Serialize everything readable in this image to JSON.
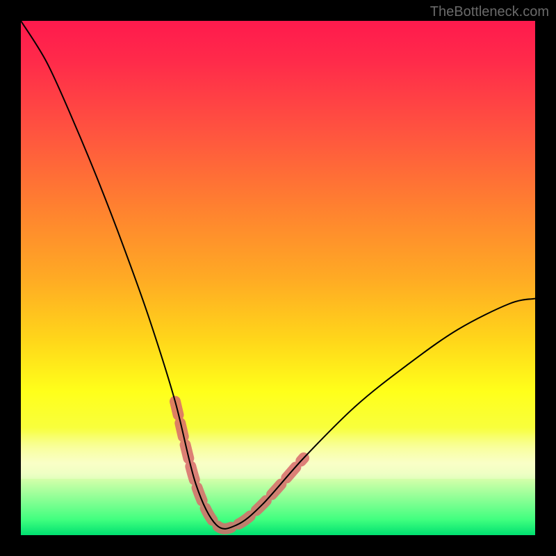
{
  "watermark": {
    "text": "TheBottleneck.com"
  },
  "colors": {
    "page_bg": "#000000",
    "curve": "#000000",
    "highlight": "#d86a6a",
    "watermark": "#6a6a6a",
    "gradient_top": "#ff1a4d",
    "gradient_mid": "#ffff1a",
    "gradient_bottom": "#00e070"
  },
  "chart_data": {
    "type": "line",
    "title": "",
    "xlabel": "",
    "ylabel": "",
    "xlim": [
      0,
      100
    ],
    "ylim": [
      0,
      100
    ],
    "grid": false,
    "legend": false,
    "description": "Bottleneck curve: y is mismatch percentage (high at left, dips to ~0 near x≈40, rises to ~46 at right). Highlighted segment x≈34–47 around the trough.",
    "x": [
      0,
      5,
      10,
      15,
      20,
      25,
      30,
      34,
      38,
      42,
      47,
      55,
      65,
      75,
      85,
      95,
      100
    ],
    "values": [
      100,
      92,
      81,
      69,
      56,
      42,
      26,
      10,
      2,
      2,
      6,
      15,
      25,
      33,
      40,
      45,
      46
    ],
    "highlight_range_x": [
      34,
      47
    ],
    "highlight_y_at_range": [
      10,
      2,
      2,
      6
    ]
  }
}
